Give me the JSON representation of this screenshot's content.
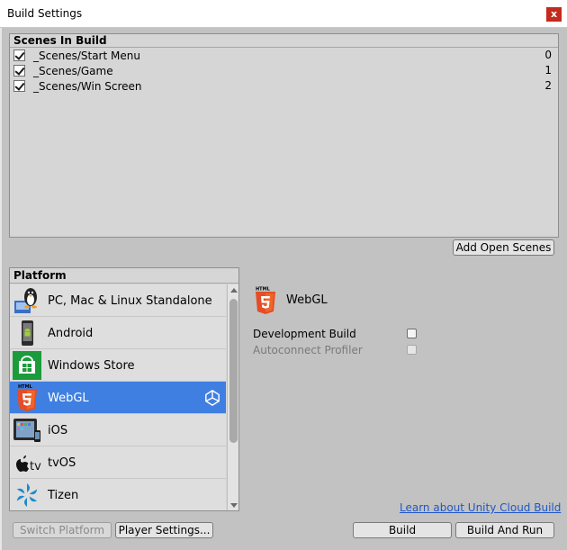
{
  "window": {
    "title": "Build Settings",
    "close_label": "x"
  },
  "scenes": {
    "header": "Scenes In Build",
    "items": [
      {
        "name": "_Scenes/Start Menu",
        "index": "0",
        "checked": true
      },
      {
        "name": "_Scenes/Game",
        "index": "1",
        "checked": true
      },
      {
        "name": "_Scenes/Win Screen",
        "index": "2",
        "checked": true
      }
    ],
    "add_open_scenes_label": "Add Open Scenes"
  },
  "platform": {
    "header": "Platform",
    "items": [
      {
        "label": "PC, Mac & Linux Standalone",
        "icon": "penguin-pc-icon"
      },
      {
        "label": "Android",
        "icon": "android-phone-icon"
      },
      {
        "label": "Windows Store",
        "icon": "windows-store-icon"
      },
      {
        "label": "WebGL",
        "icon": "html5-icon",
        "selected": true
      },
      {
        "label": "iOS",
        "icon": "ipad-icon"
      },
      {
        "label": "tvOS",
        "icon": "apple-tv-icon"
      },
      {
        "label": "Tizen",
        "icon": "tizen-icon"
      }
    ],
    "selected": "WebGL",
    "active_marker_icon": "unity-logo-icon"
  },
  "settings": {
    "title": "WebGL",
    "html5_badge_text": "HTML",
    "development_build_label": "Development Build",
    "development_build_checked": false,
    "autoconnect_profiler_label": "Autoconnect Profiler",
    "autoconnect_profiler_checked": false,
    "cloud_build_link": "Learn about Unity Cloud Build"
  },
  "buttons": {
    "switch_platform": "Switch Platform",
    "player_settings": "Player Settings...",
    "build": "Build",
    "build_and_run": "Build And Run"
  },
  "colors": {
    "selected_row": "#3f7fe1",
    "html5_orange": "#e44d26",
    "link": "#2056c8",
    "close_red": "#c42b1c"
  }
}
